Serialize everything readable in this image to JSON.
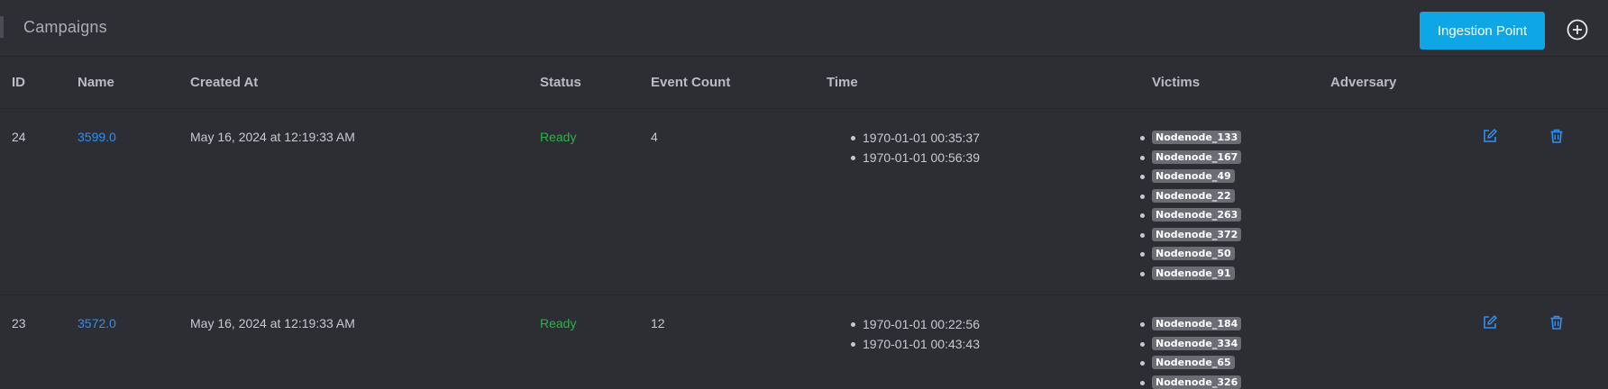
{
  "header": {
    "title": "Campaigns",
    "ingestion_button": "Ingestion Point",
    "add_icon": "plus-circle-icon"
  },
  "table": {
    "columns": [
      "ID",
      "Name",
      "Created At",
      "Status",
      "Event Count",
      "Time",
      "Victims",
      "Adversary"
    ],
    "rows": [
      {
        "id": "24",
        "name": "3599.0",
        "created_at": "May 16, 2024 at 12:19:33 AM",
        "status": "Ready",
        "event_count": "4",
        "times": [
          "1970-01-01 00:35:37",
          "1970-01-01 00:56:39"
        ],
        "victims": [
          "Nodenode_133",
          "Nodenode_167",
          "Nodenode_49",
          "Nodenode_22",
          "Nodenode_263",
          "Nodenode_372",
          "Nodenode_50",
          "Nodenode_91"
        ],
        "adversary": ""
      },
      {
        "id": "23",
        "name": "3572.0",
        "created_at": "May 16, 2024 at 12:19:33 AM",
        "status": "Ready",
        "event_count": "12",
        "times": [
          "1970-01-01 00:22:56",
          "1970-01-01 00:43:43"
        ],
        "victims": [
          "Nodenode_184",
          "Nodenode_334",
          "Nodenode_65",
          "Nodenode_326"
        ],
        "adversary": ""
      }
    ]
  },
  "colors": {
    "background": "#2c2e33",
    "accent_button": "#0fa6e6",
    "link": "#2f8ff5",
    "status_ready": "#2fb04a",
    "badge": "#6a6d74"
  },
  "icons": {
    "edit": "edit-icon",
    "delete": "trash-icon"
  }
}
